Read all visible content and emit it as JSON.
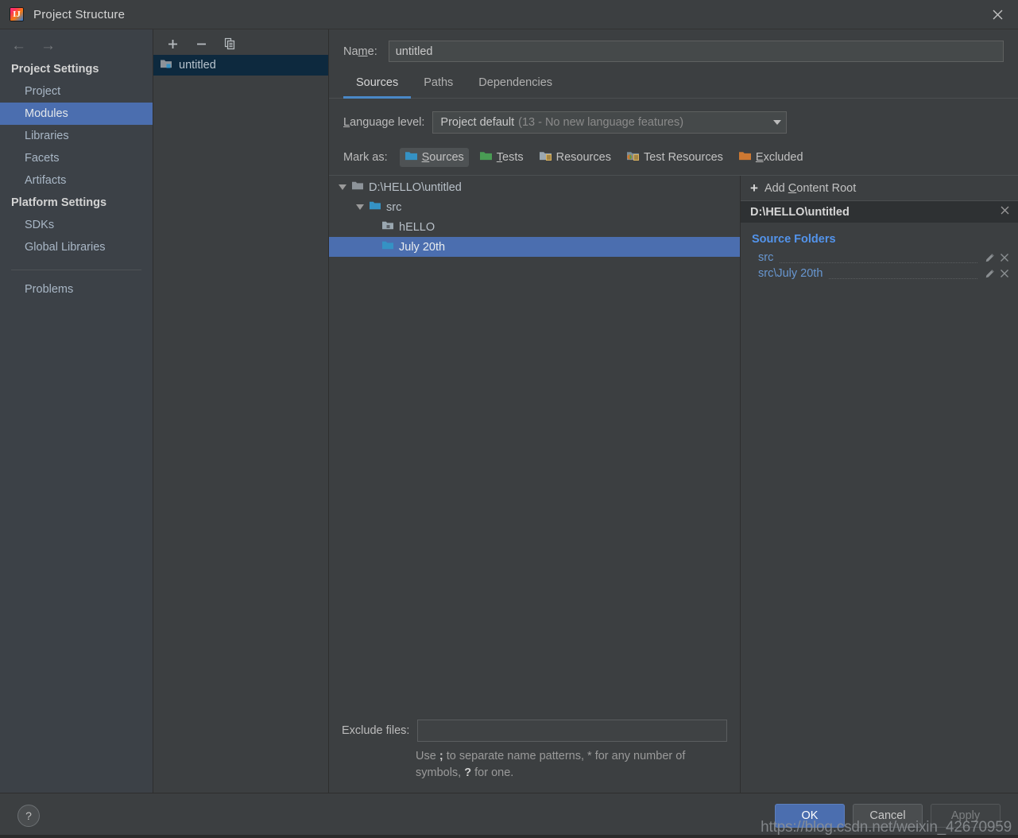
{
  "window": {
    "title": "Project Structure",
    "app_icon": "intellij-idea-icon",
    "close_icon": "close-icon"
  },
  "sidebar": {
    "nav": {
      "back_icon": "arrow-left-icon",
      "forward_icon": "arrow-right-icon"
    },
    "groups": [
      {
        "label": "Project Settings",
        "items": [
          {
            "label": "Project",
            "selected": false
          },
          {
            "label": "Modules",
            "selected": true
          },
          {
            "label": "Libraries",
            "selected": false
          },
          {
            "label": "Facets",
            "selected": false
          },
          {
            "label": "Artifacts",
            "selected": false
          }
        ]
      },
      {
        "label": "Platform Settings",
        "items": [
          {
            "label": "SDKs",
            "selected": false
          },
          {
            "label": "Global Libraries",
            "selected": false
          }
        ]
      }
    ],
    "extra_items": [
      {
        "label": "Problems",
        "selected": false
      }
    ]
  },
  "modules": {
    "toolbar": [
      {
        "name": "add-module-button",
        "glyph": "+"
      },
      {
        "name": "remove-module-button",
        "glyph": "−"
      },
      {
        "name": "copy-module-button",
        "glyph": "copy-icon"
      }
    ],
    "list": [
      {
        "label": "untitled",
        "icon": "module-folder-icon",
        "selected": true
      }
    ]
  },
  "main": {
    "name_label": "Name:",
    "name_value": "untitled",
    "tabs": [
      {
        "label": "Sources",
        "active": true
      },
      {
        "label": "Paths",
        "active": false
      },
      {
        "label": "Dependencies",
        "active": false
      }
    ],
    "language_level": {
      "label": "Language level:",
      "value": "Project default",
      "hint": "(13 - No new language features)",
      "caret_icon": "chevron-down-icon"
    },
    "mark_as": {
      "label": "Mark as:",
      "options": [
        {
          "label": "Sources",
          "color": "#3592c4",
          "active": true,
          "icon": "folder-sources-icon"
        },
        {
          "label": "Tests",
          "color": "#499c54",
          "active": false,
          "icon": "folder-tests-icon"
        },
        {
          "label": "Resources",
          "color": "#9aa7b0",
          "active": false,
          "icon": "folder-resources-icon"
        },
        {
          "label": "Test Resources",
          "color": "#499c54",
          "active": false,
          "icon": "folder-test-resources-icon"
        },
        {
          "label": "Excluded",
          "color": "#cc7832",
          "active": false,
          "icon": "folder-excluded-icon"
        }
      ]
    },
    "tree": [
      {
        "label": "D:\\HELLO\\untitled",
        "depth": 0,
        "expanded": true,
        "icon": "folder-plain-icon",
        "color": "#9aa7b0",
        "selected": false
      },
      {
        "label": "src",
        "depth": 1,
        "expanded": true,
        "icon": "folder-sources-icon",
        "color": "#3592c4",
        "selected": false
      },
      {
        "label": "hELLO",
        "depth": 2,
        "expanded": false,
        "icon": "folder-package-icon",
        "color": "#9aa7b0",
        "selected": false
      },
      {
        "label": "July 20th",
        "depth": 2,
        "expanded": false,
        "icon": "folder-sources-icon",
        "color": "#3592c4",
        "selected": true
      }
    ],
    "exclude": {
      "label": "Exclude files:",
      "value": "",
      "hint_part1": "Use ",
      "hint_sep": ";",
      "hint_part2": " to separate name patterns, * for any number of symbols, ",
      "hint_q": "?",
      "hint_part3": " for one."
    }
  },
  "right_panel": {
    "add_content_root": "Add Content Root",
    "add_icon": "plus-icon",
    "root_path": "D:\\HELLO\\untitled",
    "root_close_icon": "close-icon",
    "source_folders_title": "Source Folders",
    "source_folders": [
      {
        "path": "src",
        "edit_icon": "pencil-icon",
        "remove_icon": "close-icon"
      },
      {
        "path": "src\\July 20th",
        "edit_icon": "pencil-icon",
        "remove_icon": "close-icon"
      }
    ]
  },
  "footer": {
    "help_label": "?",
    "buttons": [
      {
        "label": "OK",
        "style": "default"
      },
      {
        "label": "Cancel",
        "style": "normal"
      },
      {
        "label": "Apply",
        "style": "disabled"
      }
    ],
    "watermark": "https://blog.csdn.net/weixin_42670959"
  },
  "colors": {
    "accent_blue": "#4b6eaf",
    "tab_underline": "#4a88c7",
    "link_blue": "#6897d1",
    "header_blue": "#5394ec",
    "bg_main": "#3c3f41",
    "bg_sidebar": "#3c4147",
    "bg_selected_inactive": "#0d293e"
  }
}
